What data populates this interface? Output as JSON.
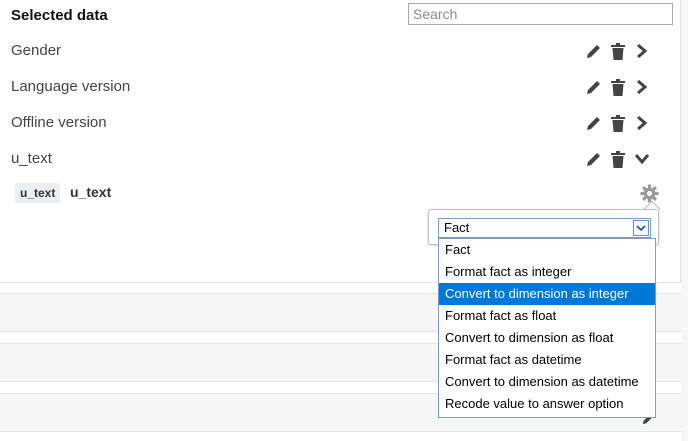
{
  "header": {
    "title": "Selected data",
    "search_placeholder": "Search",
    "search_value": ""
  },
  "rows": [
    {
      "label": "Gender",
      "expanded": false
    },
    {
      "label": "Language version",
      "expanded": false
    },
    {
      "label": "Offline version",
      "expanded": false
    },
    {
      "label": "u_text",
      "expanded": true
    }
  ],
  "row_icons": [
    "pencil-icon",
    "trash-icon",
    "chevron-right-icon"
  ],
  "detail": {
    "tag": "u_text",
    "name": "u_text",
    "settings_icon": "gear-icon"
  },
  "format_select": {
    "value": "Fact",
    "options": [
      "Fact",
      "Format fact as integer",
      "Convert to dimension as integer",
      "Format fact as float",
      "Convert to dimension as float",
      "Format fact as datetime",
      "Convert to dimension as datetime",
      "Recode value to answer option"
    ],
    "highlighted_option": "Convert to dimension as integer"
  },
  "colors": {
    "icon": "#444444",
    "highlight": "#0078d7",
    "select_border": "#7a9cc6",
    "section_bar": "#f6f6f6"
  }
}
